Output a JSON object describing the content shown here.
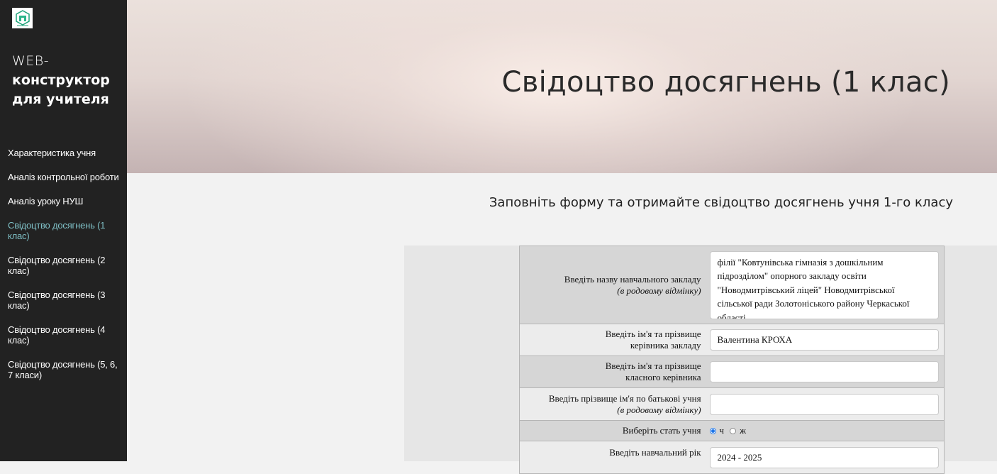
{
  "sidebar": {
    "logo_icon": "school-building-logo",
    "title_line1": "WEB-",
    "title_line2": "конструктор для учителя",
    "items": [
      {
        "label": "Характеристика учня"
      },
      {
        "label": "Аналіз контрольної роботи"
      },
      {
        "label": "Аналіз уроку НУШ"
      },
      {
        "label": "Свідоцтво досягнень (1 клас)",
        "active": true
      },
      {
        "label": "Свідоцтво досягнень (2 клас)"
      },
      {
        "label": "Свідоцтво досягнень (3 клас)"
      },
      {
        "label": "Свідоцтво досягнень (4 клас)"
      },
      {
        "label": "Свідоцтво досягнень (5, 6, 7 класи)"
      }
    ],
    "active_color": "#7fc0c6"
  },
  "hero": {
    "title": "Свідоцтво досягнень (1 клас)"
  },
  "main": {
    "subtitle": "Заповніть форму та отримайте свідоцтво досягнень учня 1-го класу"
  },
  "form": {
    "school": {
      "label": "Введіть назву навчального закладу",
      "hint": "(в родовому відмінку)",
      "value": "філії \"Ковтунівська гімназія з дошкільним підрозділом\" опорного закладу освіти \"Новодмитрівський ліцей\" Новодмитрівської сільської ради Золотоніського району Черкаської області"
    },
    "director": {
      "label_line1": "Введіть ім'я та прізвище",
      "label_line2": "керівника закладу",
      "value": "Валентина КРОХА"
    },
    "teacher": {
      "label_line1": "Введіть ім'я та прізвище",
      "label_line2": "класного керівника",
      "value": ""
    },
    "student": {
      "label": "Введіть прізвище ім'я по батькові учня",
      "hint": "(в родовому відмінку)",
      "value": ""
    },
    "gender": {
      "label": "Виберіть стать учня",
      "option_m": "ч",
      "option_f": "ж",
      "selected": "ч"
    },
    "year": {
      "label": "Введіть навчальний рік",
      "value": "2024 - 2025"
    }
  }
}
